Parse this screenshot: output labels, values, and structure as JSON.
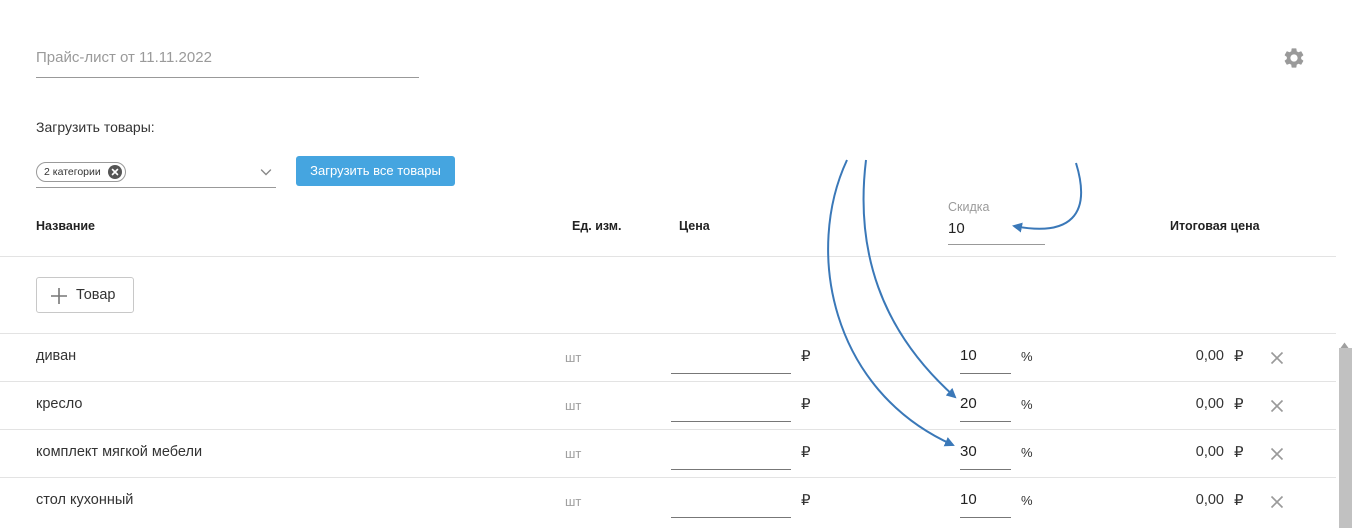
{
  "header": {
    "title": "Прайс-лист от 11.11.2022",
    "settings_icon": "gear-icon"
  },
  "loader": {
    "label": "Загрузить товары:",
    "selected_chip": "2 категории",
    "load_all_button": "Загрузить все товары"
  },
  "table": {
    "columns": {
      "name": "Название",
      "unit": "Ед. изм.",
      "price": "Цена",
      "discount_label": "Скидка",
      "discount_value": "10",
      "total": "Итоговая цена"
    },
    "add_button": "Товар",
    "currency": "₽",
    "percent": "%",
    "rows": [
      {
        "name": "диван",
        "unit": "шт",
        "price": "",
        "discount": "10",
        "total": "0,00"
      },
      {
        "name": "кресло",
        "unit": "шт",
        "price": "",
        "discount": "20",
        "total": "0,00"
      },
      {
        "name": "комплект мягкой мебели",
        "unit": "шт",
        "price": "",
        "discount": "30",
        "total": "0,00"
      },
      {
        "name": "стол кухонный",
        "unit": "шт",
        "price": "",
        "discount": "10",
        "total": "0,00"
      }
    ]
  },
  "colors": {
    "accent_button": "#45a5e0",
    "annotation_arrow": "#3a78b8",
    "muted_text": "#9a9a9a"
  }
}
